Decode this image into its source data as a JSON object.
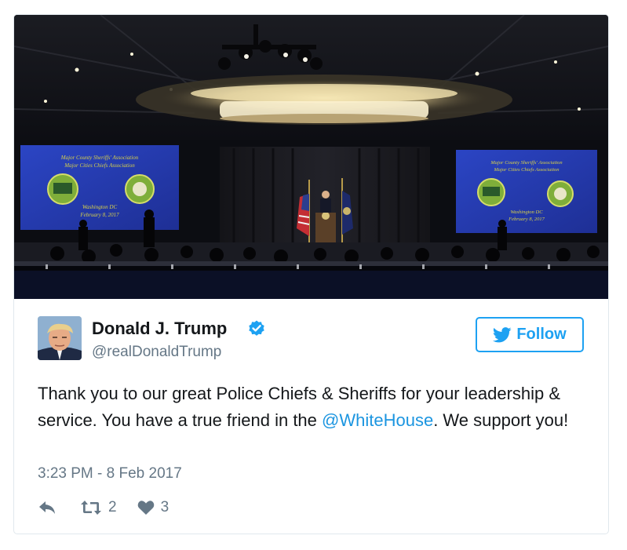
{
  "media": {
    "slides": [
      {
        "line1": "Major County Sheriffs' Association",
        "line2": "Major Cities Chiefs Association",
        "line3": "Washington DC",
        "line4": "February 8, 2017"
      },
      {
        "line1": "Major County Sheriffs' Association",
        "line2": "Major Cities Chiefs Association",
        "line3": "Washington DC",
        "line4": "February 8, 2017"
      }
    ]
  },
  "author": {
    "name": "Donald J. Trump",
    "handle": "@realDonaldTrump",
    "avatar_icon": "avatar-photo",
    "verified_icon": "verified-badge-icon"
  },
  "follow": {
    "label": "Follow",
    "icon": "bird-icon"
  },
  "tweet": {
    "text_part1": "Thank you to our great Police Chiefs & Sheriffs for your leadership & service. You have a true friend in the ",
    "mention": "@WhiteHouse",
    "text_part2": ". We support you!",
    "timestamp": "3:23 PM - 8 Feb 2017"
  },
  "actions": {
    "reply_icon": "reply-icon",
    "retweet_icon": "retweet-icon",
    "like_icon": "heart-icon",
    "retweets": "2",
    "likes": "3"
  },
  "colors": {
    "twitter_blue": "#1da1f2",
    "mention_blue": "#1b95e0",
    "text": "#14171a",
    "muted": "#657786",
    "border": "#e1e8ed"
  }
}
